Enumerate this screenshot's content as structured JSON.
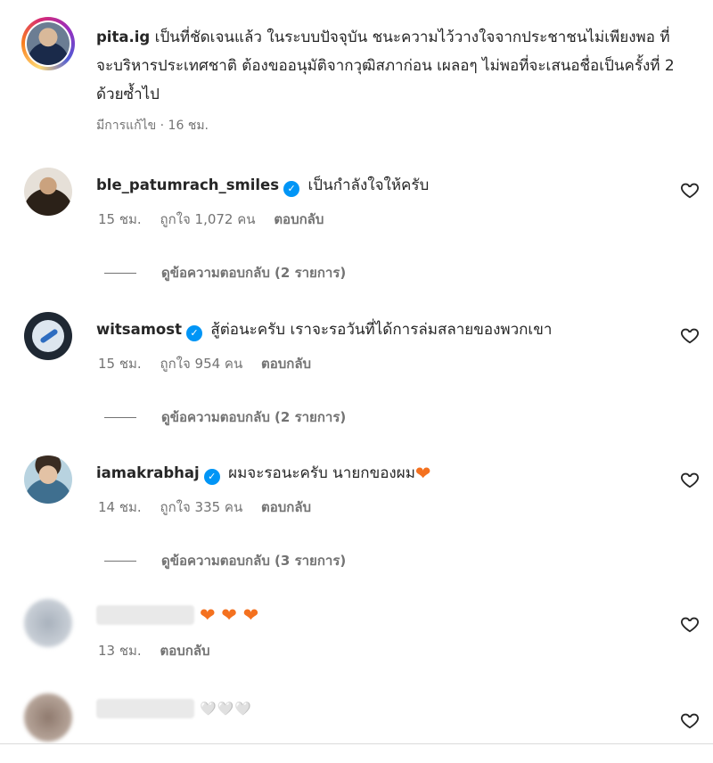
{
  "caption": {
    "username": "pita.ig",
    "text": "เป็นที่ชัดเจนแล้ว ในระบบปัจจุบัน ชนะความไว้วางใจจากประชาชนไม่เพียงพอ ที่จะบริหารประเทศชาติ ต้องขออนุมัติจากวุฒิสภาก่อน เผลอๆ ไม่พอที่จะเสนอชื่อเป็นครั้งที่ 2 ด้วยซ้ำไป",
    "meta": "มีการแก้ไข · 16 ชม."
  },
  "comments": [
    {
      "username": "ble_patumrach_smiles",
      "text": "เป็นกำลังใจให้ครับ",
      "time": "15 ชม.",
      "likes": "ถูกใจ 1,072 คน",
      "reply_label": "ตอบกลับ",
      "view_replies": "ดูข้อความตอบกลับ (2 รายการ)"
    },
    {
      "username": "witsamost",
      "text": "สู้ต่อนะครับ เราจะรอวันที่ได้การล่มสลายของพวกเขา",
      "time": "15 ชม.",
      "likes": "ถูกใจ 954 คน",
      "reply_label": "ตอบกลับ",
      "view_replies": "ดูข้อความตอบกลับ (2 รายการ)"
    },
    {
      "username": "iamakrabhaj",
      "text": "ผมจะรอนะครับ นายกของผม",
      "time": "14 ชม.",
      "likes": "ถูกใจ 335 คน",
      "reply_label": "ตอบกลับ",
      "view_replies": "ดูข้อความตอบกลับ (3 รายการ)"
    },
    {
      "time": "13 ชม.",
      "reply_label": "ตอบกลับ"
    },
    {
      "text": "🤍🤍🤍"
    }
  ],
  "icons": {
    "verified": "verified-badge-icon",
    "like": "heart-outline-icon"
  },
  "colors": {
    "verified": "#0095f6",
    "secondary_text": "#737373",
    "orange_heart": "#f4711f"
  }
}
